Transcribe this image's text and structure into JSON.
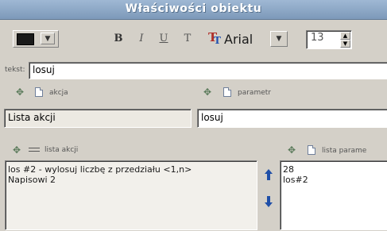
{
  "window": {
    "title": "Właściwości obiektu"
  },
  "toolbar": {
    "bold_label": "B",
    "italic_label": "I",
    "underline_label": "U",
    "plain_label": "T",
    "font_name": "Arial",
    "font_size": "13"
  },
  "tekst": {
    "label": "tekst:",
    "value": "losuj"
  },
  "akcja": {
    "label": "akcja",
    "value": "Lista akcji"
  },
  "parametr": {
    "label": "parametr",
    "value": "losuj"
  },
  "lista_akcji": {
    "label": "lista akcji",
    "items": [
      "los #2 - wylosuj liczbę z przedziału <1,n>",
      "Napisowi 2"
    ]
  },
  "lista_param": {
    "label": "lista parame",
    "items": [
      "28",
      "los#2"
    ]
  },
  "colors": {
    "title_bar": "#8aa6c4",
    "panel": "#d4d0c8",
    "arrow_blue": "#1f4fa8"
  }
}
